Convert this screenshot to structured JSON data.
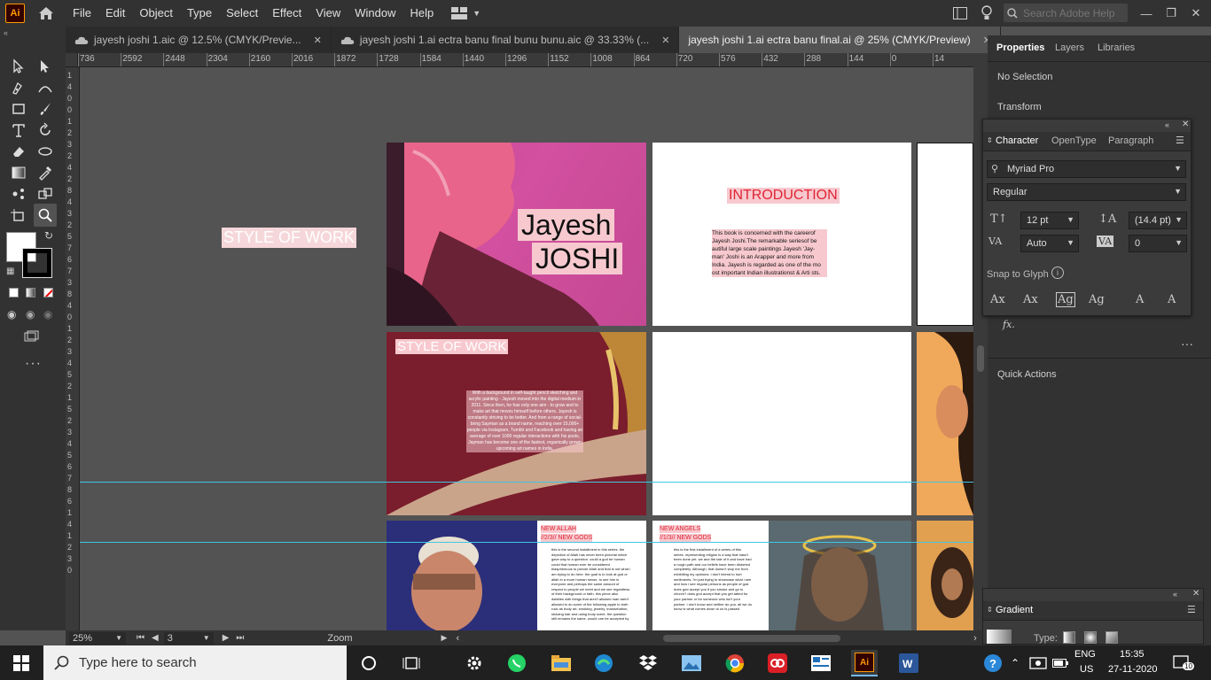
{
  "app": {
    "logo": "Ai"
  },
  "menu": [
    "File",
    "Edit",
    "Object",
    "Type",
    "Select",
    "Effect",
    "View",
    "Window",
    "Help"
  ],
  "search": {
    "placeholder": "Search Adobe Help"
  },
  "tabs": [
    {
      "label": "jayesh joshi 1.aic @ 12.5% (CMYK/Previe...",
      "cloud": true,
      "active": false
    },
    {
      "label": "jayesh joshi 1.ai ectra banu final bunu bunu.aic @ 33.33% (...",
      "cloud": true,
      "active": false
    },
    {
      "label": "jayesh joshi 1.ai ectra banu final.ai @ 25% (CMYK/Preview)",
      "cloud": false,
      "active": true
    }
  ],
  "ruler": {
    "h": [
      "736",
      "2592",
      "2448",
      "2304",
      "2160",
      "2016",
      "1872",
      "1728",
      "1584",
      "1440",
      "1296",
      "1152",
      "1008",
      "864",
      "720",
      "576",
      "432",
      "288",
      "144",
      "0",
      "14"
    ],
    "v": [
      "1",
      "4",
      "0",
      "0",
      "1",
      "2",
      "3",
      "2",
      "4",
      "2",
      "8",
      "4",
      "3",
      "2",
      "5",
      "7",
      "6",
      "7",
      "3",
      "8",
      "4",
      "0",
      "1",
      "2",
      "3",
      "4",
      "5",
      "2",
      "1",
      "5",
      "2",
      "3",
      "4",
      "5",
      "6",
      "7",
      "8",
      "6",
      "1",
      "4",
      "1",
      "2",
      "3",
      "0"
    ]
  },
  "canvas": {
    "style_label": "STYLE OF WORK",
    "page1": {
      "name_line1": "Jayesh",
      "name_line2": "JOSHI"
    },
    "page2": {
      "title": "INTRODUCTION",
      "body": "This book is concerned with the careerof Jayesh Joshi.The remarkable seriesof be autiful large scale paintings Jayesh 'Jay-man' Joshi is an Arapper and more from India. Jayesh is regarded as one of the mo ost important Indian illustrationst & Arti sts."
    },
    "page4": {
      "title": "STYLE OF WORK",
      "body": "With a background in self-taught pencil sketching and acrylic painting - Jayesh moved into the digital medium in 2011. Since then, he has only one aim - to grow and to make art that moves himself before others. Jayesh is constantly striving to be better. And from a range of social-bring Sayman as a brand name, reaching over 15,000+ people via Instagram, Tumblr and Facebook and having an average of over 1000 regular interactions with his posts, Jayman has become one of the fastest, organically grown upcoming art names in India."
    },
    "page7": {
      "title1": "NEW ALLAH",
      "title2": "//2/3// NEW GODS",
      "body": "this is the second installment in this series. the depiction of Allah has never been pictorial which gave way to a question. could a god be human could that human ever be considered blasphemous to picture Allah and that is not what i am trying to do here. the goal is to look at god or allah in a more human sense, to see him in everyone and perhaps the same amount of respect to people we meet and we see regardless of their background or faith. this piece also dabbles with things that aren't allowed man aren't allowed to do some of the following apple to both rock as body art, smoking, jewelry, masturbation, shaving hair and using body scent. the question still remains the same. would one be accepted by"
    },
    "page8": {
      "title1": "NEW ANGELS",
      "title2": "//1/3// NEW GODS",
      "body": "this is the first installment of a series of this series. representing religion is a way that hasn't been done yet. we and the tale of it and have had a rough path and our beliefs have been distorted completely. Although, that doesn't stop me from exhibiting my opinions. i don't intend to hurt sentiments. i'm just trying to showcase what i see and how i see regular persons as people of god. does god accept you if you smoke and go to church? does god accept that you get tatted for your partner or for someone who isn't your partner. i don't know and neither do you. all we do know is what comes down to us is passed"
    }
  },
  "status": {
    "zoom": "25%",
    "page": "3",
    "mode": "Zoom"
  },
  "properties": {
    "tabs": [
      "Properties",
      "Layers",
      "Libraries"
    ],
    "no_selection": "No Selection",
    "transform": "Transform",
    "quick_actions": "Quick Actions",
    "fx": "fx."
  },
  "character": {
    "tabs": [
      "Character",
      "OpenType",
      "Paragraph"
    ],
    "font_family": "Myriad Pro",
    "font_style": "Regular",
    "size": "12 pt",
    "leading": "(14.4 pt)",
    "kerning": "Auto",
    "tracking": "0",
    "snap_to_glyph": "Snap to Glyph"
  },
  "gradient": {
    "title": "Gradient",
    "type_label": "Type:"
  },
  "taskbar": {
    "search_placeholder": "Type here to search",
    "lang1": "ENG",
    "lang2": "US",
    "time": "15:35",
    "date": "27-11-2020",
    "notif": "10"
  },
  "colors": {
    "accent_ai": "#ff9a00",
    "intro_red": "#e02433",
    "guide": "#3fc6e4"
  }
}
